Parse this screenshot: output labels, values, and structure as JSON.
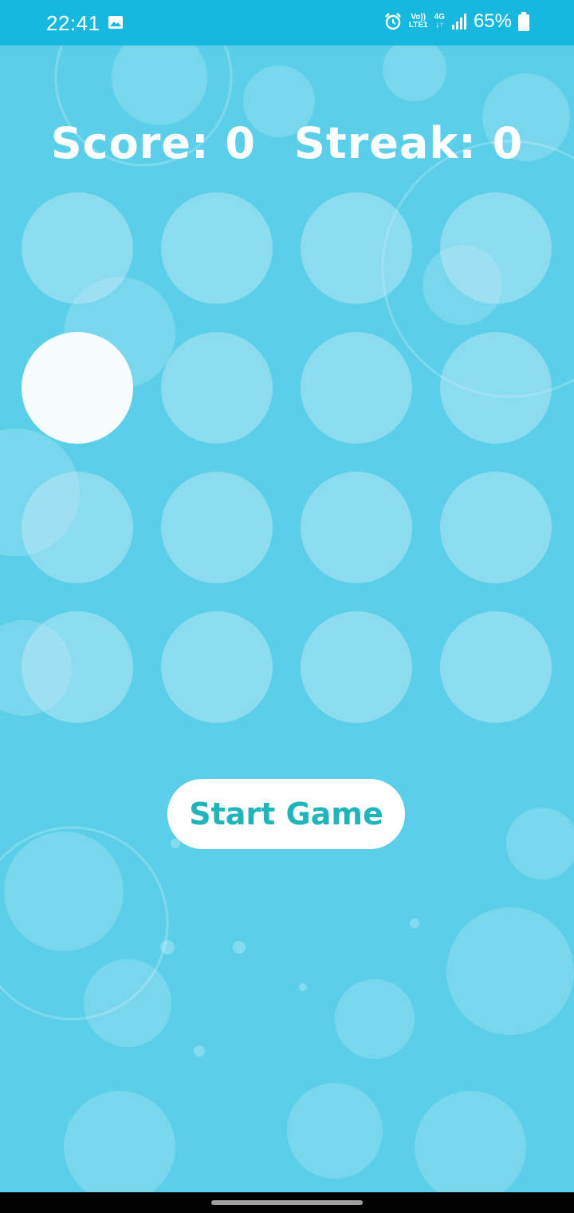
{
  "status_bar": {
    "time": "22:41",
    "volte_line1": "Vo))",
    "volte_line2": "LTE1",
    "network": "4G",
    "battery": "65%",
    "icons": [
      "gallery-icon",
      "alarm-icon",
      "signal-icon",
      "battery-icon"
    ]
  },
  "game": {
    "score_label": "Score: 0",
    "streak_label": "Streak: 0",
    "grid": {
      "rows": 4,
      "cols": 4,
      "active_cell": [
        1,
        0
      ]
    },
    "start_button": "Start Game"
  },
  "colors": {
    "status_bar": "#16b8e0",
    "background": "#5bcfe9",
    "button_text": "#20b5ba",
    "active_cell": "#f7fcfe"
  }
}
